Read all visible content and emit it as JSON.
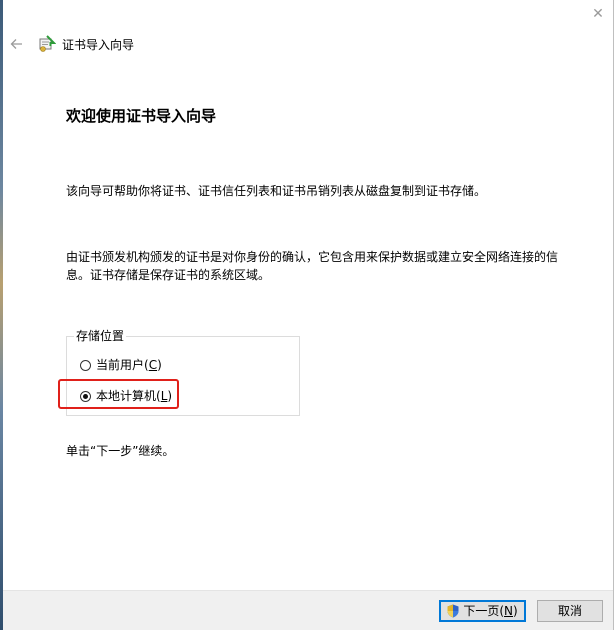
{
  "window": {
    "title": "证书导入向导",
    "close_glyph": "✕"
  },
  "content": {
    "heading": "欢迎使用证书导入向导",
    "intro": "该向导可帮助你将证书、证书信任列表和证书吊销列表从磁盘复制到证书存储。",
    "description": "由证书颁发机构颁发的证书是对你身份的确认，它包含用来保护数据或建立安全网络连接的信息。证书存储是保存证书的系统区域。",
    "store_location": {
      "legend": "存储位置",
      "options": [
        {
          "label": "当前用户",
          "accel": "C",
          "selected": false
        },
        {
          "label": "本地计算机",
          "accel": "L",
          "selected": true
        }
      ]
    },
    "continue_note": "单击“下一步”继续。"
  },
  "buttons": {
    "next_label": "下一页",
    "next_accel": "N",
    "cancel_label": "取消"
  },
  "icons": {
    "back": "back-arrow-icon",
    "wizard": "certificate-wizard-icon",
    "shield": "uac-shield-icon",
    "close": "close-icon"
  },
  "colors": {
    "highlight": "#e0201a",
    "default_button_border": "#0078d7",
    "bottom_bar": "#f0f0f0"
  }
}
